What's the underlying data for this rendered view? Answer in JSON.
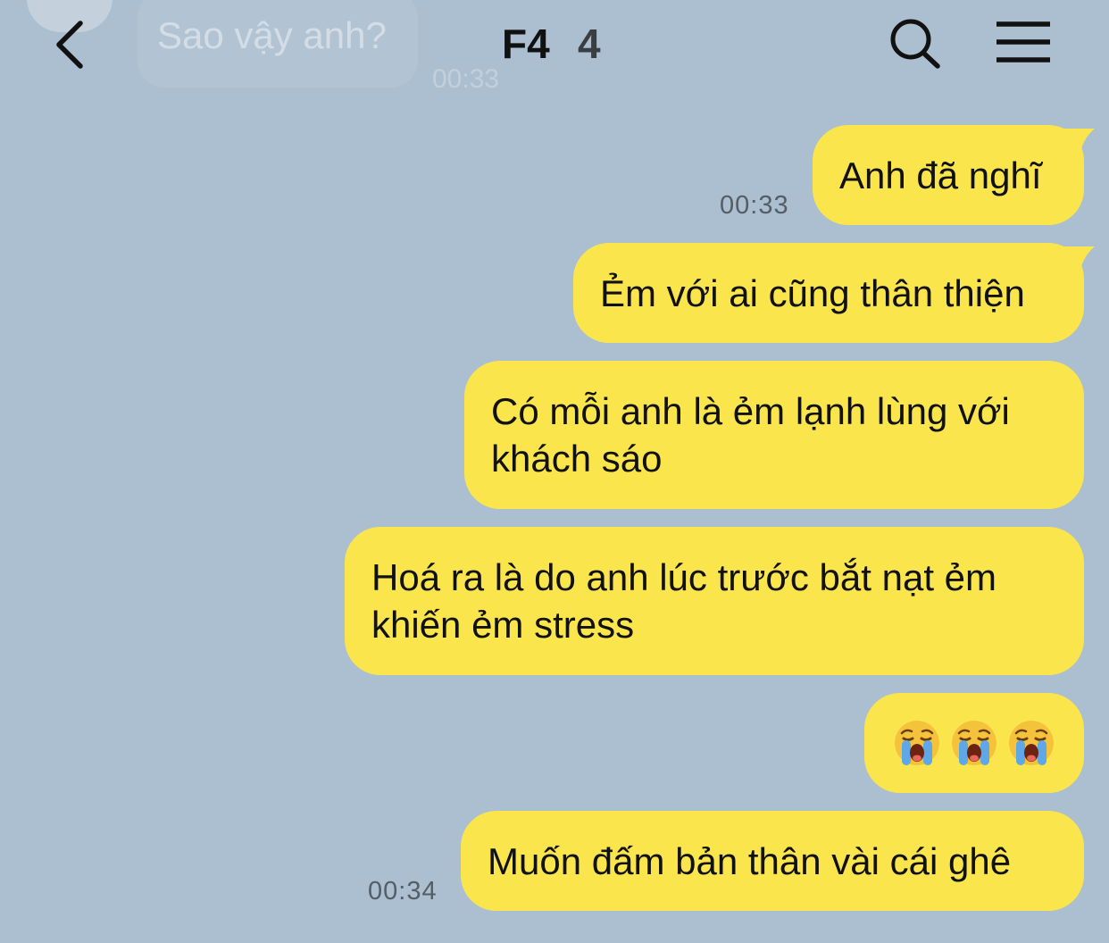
{
  "header": {
    "title": "F4",
    "member_count": "4"
  },
  "background_message": {
    "text": "Sao vậy anh?",
    "time": "00:33"
  },
  "messages": [
    {
      "text": "Anh đã nghĩ",
      "time": "00:33"
    },
    {
      "text": "Ẻm với ai cũng thân thiện"
    },
    {
      "text": "Có mỗi anh là ẻm lạnh lùng với khách sáo"
    },
    {
      "text": "Hoá ra là do anh lúc trước bắt nạt ẻm khiến ẻm stress"
    },
    {
      "emoji": [
        "loudly-crying-face",
        "loudly-crying-face",
        "loudly-crying-face"
      ]
    },
    {
      "text": "Muốn đấm bản thân vài cái ghê",
      "time": "00:34"
    }
  ],
  "colors": {
    "background": "#abbfd0",
    "bubble": "#fae64c"
  }
}
